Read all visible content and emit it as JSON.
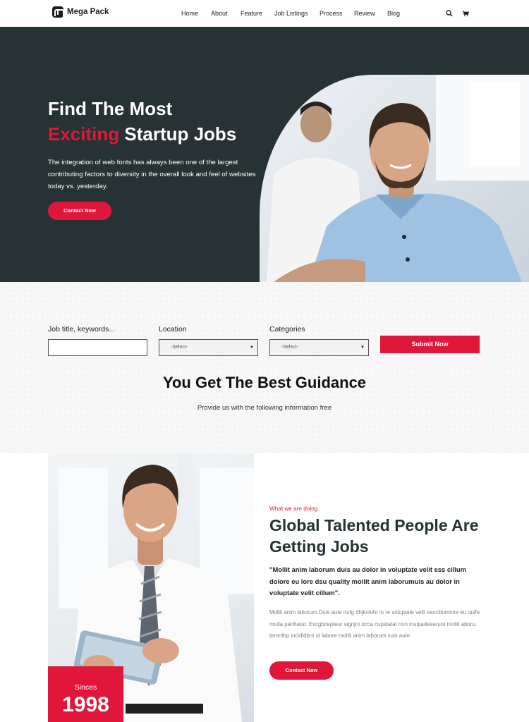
{
  "brand": {
    "name": "Mega Pack"
  },
  "nav": {
    "items": [
      "Home",
      "About",
      "Feature",
      "Job Listings",
      "Process",
      "Review",
      "Blog"
    ],
    "icons": [
      "search-icon",
      "cart-icon"
    ]
  },
  "hero": {
    "title_line1": "Find The Most",
    "title_accent": "Exciting",
    "title_line2_rest": " Startup Jobs",
    "description": "The integration of web fonts has always been one of the largest contributing factors to diversity in the overall look and feel of websites today vs. yesterday.",
    "cta_label": "Contact Now"
  },
  "search": {
    "keywords_label": "Job title, keywords...",
    "keywords_value": "",
    "location_label": "Location",
    "location_selected": "-Select-",
    "categories_label": "Categories",
    "categories_selected": "-Select-",
    "submit_label": "Submit Now",
    "section_title": "You Get The Best Guidance",
    "section_subtitle": "Provide us with the following information free"
  },
  "about": {
    "since_label": "Sinces",
    "since_year": "1998",
    "eyebrow": "What we are doing",
    "title": "Global Talented People Are Getting Jobs",
    "quote": "\"Mollit anim laborum duis au dolor in voluptate velit ess cillum dolore eu lore dsu quality mollit anim laborumuis au dolor in voluptate velit cillum\".",
    "paragraph": "Mollit anim laborum.Duis aute irufg dhjkolohr in re voluptate velit esscillumlore eu quife nrulla parihatur. Excghcepteur signjnt occa cupidatat non inulpadeserunt mollit aboru. temnthp incididbnt ut labore mollit anim laborum suis aute.",
    "cta_label": "Contact Now"
  },
  "colors": {
    "accent": "#e0173a",
    "hero_bg": "#263233",
    "heading": "#263233"
  }
}
